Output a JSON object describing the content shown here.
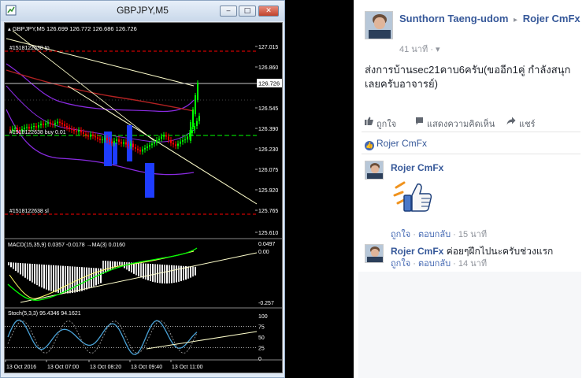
{
  "mt4": {
    "window_title": "GBPJPY,M5",
    "buttons": {
      "minimize": "‒",
      "maximize": "□",
      "close": "✕"
    },
    "chart": {
      "info_line": "▴ GBPJPY,M5  126.699 126.772 126.686 126.726",
      "price_axis": [
        "127.015",
        "126.860",
        "126.726",
        "126.545",
        "126.390",
        "126.230",
        "126.075",
        "125.920",
        "125.765",
        "125.610"
      ],
      "current_price": "126.726",
      "order_tp_label": "#1518122638 tp",
      "order_buy_label": "#1518122638 buy 0.01",
      "order_sl_label": "#1518122638 sl",
      "macd_label": "MACD(15,35,9) 0.0357 -0.0178  →MA(3) 0.0160",
      "macd_axis_top": "0.0497",
      "macd_axis_zero": "0.00",
      "macd_axis_bottom": "-0.257",
      "stoch_label": "Stoch(5,3,3) 95.4346 94.1621",
      "stoch_axis": [
        "100",
        "75",
        "50",
        "25",
        "0"
      ],
      "time_axis": [
        "13 Oct 2016",
        "13 Oct 07:00",
        "13 Oct 08:20",
        "13 Oct 09:40",
        "13 Oct 11:00"
      ],
      "colors": {
        "bull": "#00ff00",
        "bear": "#ff0000",
        "buy_line": "#00ff00",
        "sl_tp": "#ff0000",
        "band": "#8a2be2",
        "ma": "#b22222",
        "trend": "#ffffcc",
        "signal": "#1e3cff",
        "stoch": "#4aa3d8"
      }
    }
  },
  "facebook": {
    "post": {
      "author": "Sunthorn Taeng-udom",
      "separator": "▸",
      "target": "Rojer CmFx",
      "time": "41 นาที",
      "privacy_dot": "·",
      "privacy_icon": "▾",
      "text": "ส่งการบ้านsec21คาบ6ครับ(ขออีก1คู่ กำลังสนุกเลยครับอาจารย์)"
    },
    "actions": {
      "like": "ถูกใจ",
      "comment": "แสดงความคิดเห็น",
      "share": "แชร์"
    },
    "likes": {
      "names": "Rojer CmFx"
    },
    "comments": [
      {
        "author": "Rojer CmFx",
        "text": "",
        "like": "ถูกใจ",
        "reply": "ตอบกลับ",
        "time": "15 นาที",
        "sticker": "thumbs-up sticker"
      },
      {
        "author": "Rojer CmFx",
        "text": "ค่อยๆฝึกไปนะครับช่วงแรก",
        "like": "ถูกใจ",
        "reply": "ตอบกลับ",
        "time": "14 นาที"
      }
    ],
    "dot": "·",
    "colors": {
      "link": "#365899",
      "muted": "#90949c",
      "text": "#1d2129"
    }
  }
}
